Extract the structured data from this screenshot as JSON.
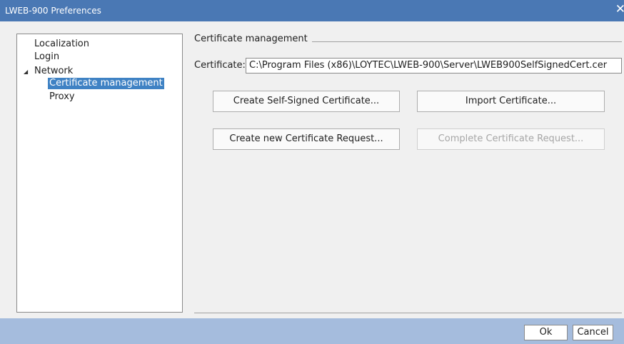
{
  "window": {
    "title": "LWEB-900 Preferences",
    "close_glyph": "✕"
  },
  "tree": {
    "items": [
      {
        "label": "Localization"
      },
      {
        "label": "Login"
      },
      {
        "label": "Network",
        "expander": "◢"
      },
      {
        "label": "Certificate management",
        "selected": true
      },
      {
        "label": "Proxy"
      }
    ]
  },
  "panel": {
    "group_title": "Certificate management",
    "certificate_label": "Certificate:",
    "certificate_value": "C:\\Program Files (x86)\\LOYTEC\\LWEB-900\\Server\\LWEB900SelfSignedCert.cer",
    "buttons": {
      "create_self_signed": "Create Self-Signed Certificate...",
      "import": "Import Certificate...",
      "create_request": "Create new Certificate Request...",
      "complete_request": "Complete Certificate Request..."
    }
  },
  "footer": {
    "ok": "Ok",
    "cancel": "Cancel"
  },
  "colors": {
    "title_bar": "#4a78b4",
    "selection": "#3f82c4",
    "footer": "#a5bcdd"
  }
}
